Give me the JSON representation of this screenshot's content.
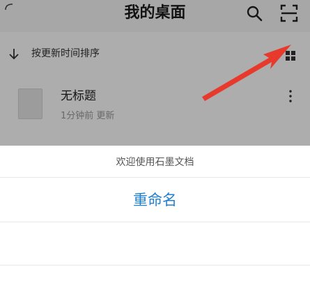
{
  "header": {
    "title": "我的桌面",
    "icons": [
      "back-icon",
      "search-icon",
      "scan-icon"
    ]
  },
  "sort": {
    "label": "按更新时间排序",
    "icons": [
      "sort-arrow-icon",
      "grid-view-icon"
    ]
  },
  "documents": [
    {
      "name": "无标题",
      "meta": "1分钟前  更新"
    }
  ],
  "sheet": {
    "title": "欢迎使用石墨文档",
    "options": [
      "重命名",
      "",
      ""
    ]
  },
  "colors": {
    "accent": "#1f7fd1",
    "annotation_arrow": "#e8392d",
    "overlay": "rgba(0,0,0,0.32)"
  }
}
